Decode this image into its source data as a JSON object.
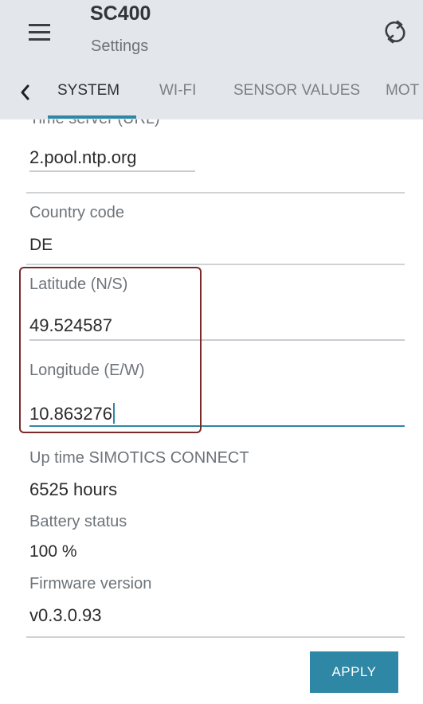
{
  "app": {
    "title": "SC400",
    "subtitle": "Settings"
  },
  "icons": {
    "menu": "hamburger-menu-icon",
    "refresh": "refresh-icon",
    "back": "chevron-left-icon"
  },
  "tabs": [
    {
      "label": "SYSTEM",
      "active": true
    },
    {
      "label": "WI-FI",
      "active": false
    },
    {
      "label": "SENSOR VALUES",
      "active": false
    },
    {
      "label": "MOT",
      "active": false
    }
  ],
  "settings": {
    "ntp_label": "Time server (URL)",
    "ntp_value": "2.pool.ntp.org",
    "country_label": "Country code",
    "country_value": "DE",
    "latitude_label": "Latitude (N/S)",
    "latitude_value": "49.524587",
    "longitude_label": "Longitude (E/W)",
    "longitude_value": "10.863276",
    "uptime_label": "Up time SIMOTICS CONNECT",
    "uptime_value": "6525  hours",
    "battery_label": "Battery status",
    "battery_value": "100 %",
    "firmware_label": "Firmware version",
    "firmware_value": "v0.3.0.93"
  },
  "actions": {
    "apply_label": "APPLY"
  },
  "colors": {
    "accent": "#2e87a5",
    "appbar": "#e3e7eb",
    "highlight_border": "#7a2a2a"
  }
}
